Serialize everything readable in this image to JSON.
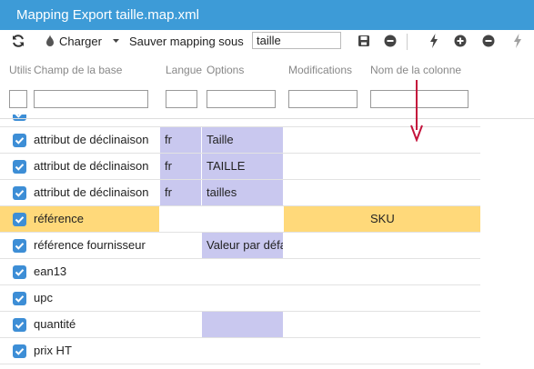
{
  "window": {
    "title": "Mapping Export taille.map.xml"
  },
  "toolbar": {
    "load_label": "Charger",
    "save_as_label": "Sauver mapping sous",
    "mapping_name_value": "taille",
    "icons": [
      "refresh-icon",
      "load-icon",
      "dropdown-caret-icon",
      "save-icon",
      "remove-mapping-icon",
      "bolt-icon",
      "add-row-icon",
      "remove-row-icon",
      "bolt-disabled-icon"
    ]
  },
  "table": {
    "columns": {
      "use": "Utilis",
      "field": "Champ de la base",
      "language": "Langue",
      "options": "Options",
      "modifications": "Modifications",
      "column_name": "Nom de la colonne"
    },
    "rows": [
      {
        "field": "",
        "language": "",
        "options": "",
        "modifications": "",
        "column_name": "",
        "checked": true,
        "partial": true
      },
      {
        "field": "attribut de déclinaison",
        "language": "fr",
        "options": "Taille",
        "modifications": "",
        "column_name": "",
        "checked": true
      },
      {
        "field": "attribut de déclinaison",
        "language": "fr",
        "options": "TAILLE",
        "modifications": "",
        "column_name": "",
        "checked": true
      },
      {
        "field": "attribut de déclinaison",
        "language": "fr",
        "options": "tailles",
        "modifications": "",
        "column_name": "",
        "checked": true
      },
      {
        "field": "référence",
        "language": "",
        "options": "",
        "modifications": "",
        "column_name": "SKU",
        "checked": true,
        "selected": true
      },
      {
        "field": "référence fournisseur",
        "language": "",
        "options": "Valeur par défaut",
        "modifications": "",
        "column_name": "",
        "checked": true
      },
      {
        "field": "ean13",
        "language": "",
        "options": "",
        "modifications": "",
        "column_name": "",
        "checked": true
      },
      {
        "field": "upc",
        "language": "",
        "options": "",
        "modifications": "",
        "column_name": "",
        "checked": true
      },
      {
        "field": "quantité",
        "language": "",
        "options": "",
        "modifications": "",
        "column_name": "",
        "checked": true
      },
      {
        "field": "prix HT",
        "language": "",
        "options": "",
        "modifications": "",
        "column_name": "",
        "checked": true
      }
    ]
  },
  "colors": {
    "title_bar": "#3d9bd7",
    "selected_row": "#ffd97a",
    "option_cell": "#c9c8ef",
    "checkbox": "#3d8ed6",
    "annotation_arrow": "#c4143c"
  }
}
